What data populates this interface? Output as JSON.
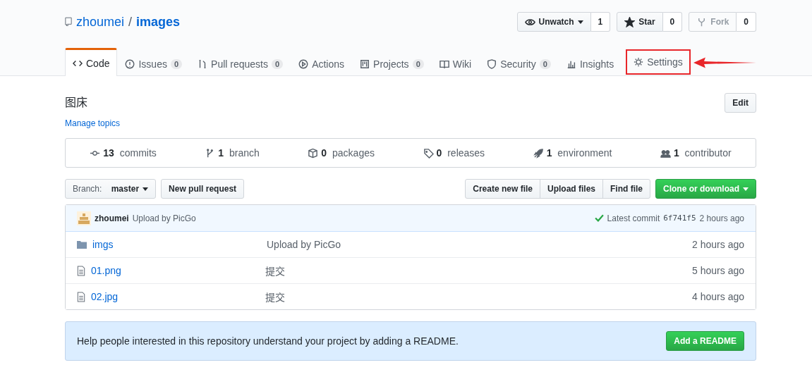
{
  "repo": {
    "owner": "zhoumei",
    "separator": "/",
    "name": "images"
  },
  "header_buttons": [
    {
      "kind": "watch",
      "label": "Unwatch",
      "dropdown": true,
      "count": "1",
      "disabled": false
    },
    {
      "kind": "star",
      "label": "Star",
      "dropdown": false,
      "count": "0",
      "disabled": false
    },
    {
      "kind": "fork",
      "label": "Fork",
      "dropdown": false,
      "count": "0",
      "disabled": true
    }
  ],
  "tabs": [
    {
      "label": "Code",
      "selected": true,
      "highlighted": false
    },
    {
      "label": "Issues",
      "count": "0",
      "selected": false,
      "highlighted": false
    },
    {
      "label": "Pull requests",
      "count": "0",
      "selected": false,
      "highlighted": false
    },
    {
      "label": "Actions",
      "selected": false,
      "highlighted": false
    },
    {
      "label": "Projects",
      "count": "0",
      "selected": false,
      "highlighted": false
    },
    {
      "label": "Wiki",
      "selected": false,
      "highlighted": false
    },
    {
      "label": "Security",
      "count": "0",
      "selected": false,
      "highlighted": false
    },
    {
      "label": "Insights",
      "selected": false,
      "highlighted": false
    },
    {
      "label": "Settings",
      "selected": false,
      "highlighted": true
    }
  ],
  "description": "图床",
  "manage_topics": "Manage topics",
  "edit_button": "Edit",
  "stats": [
    {
      "number": "13",
      "label": "commits"
    },
    {
      "number": "1",
      "label": "branch"
    },
    {
      "number": "0",
      "label": "packages"
    },
    {
      "number": "0",
      "label": "releases"
    },
    {
      "number": "1",
      "label": "environment"
    },
    {
      "number": "1",
      "label": "contributor"
    }
  ],
  "branch_button": {
    "prefix": "Branch:",
    "value": "master"
  },
  "new_pr_button": "New pull request",
  "file_buttons": [
    "Create new file",
    "Upload files",
    "Find file"
  ],
  "clone_button": "Clone or download",
  "commit": {
    "author": "zhoumei",
    "message": "Upload by PicGo",
    "prefix": "Latest commit",
    "sha": "6f741f5",
    "age": "2 hours ago"
  },
  "files": [
    {
      "kind": "folder",
      "name": "imgs",
      "message": "Upload by PicGo",
      "age": "2 hours ago"
    },
    {
      "kind": "file",
      "name": "01.png",
      "message": "提交",
      "age": "5 hours ago"
    },
    {
      "kind": "file",
      "name": "02.jpg",
      "message": "提交",
      "age": "4 hours ago"
    }
  ],
  "readme_banner": {
    "text": "Help people interested in this repository understand your project by adding a README.",
    "button": "Add a README"
  }
}
